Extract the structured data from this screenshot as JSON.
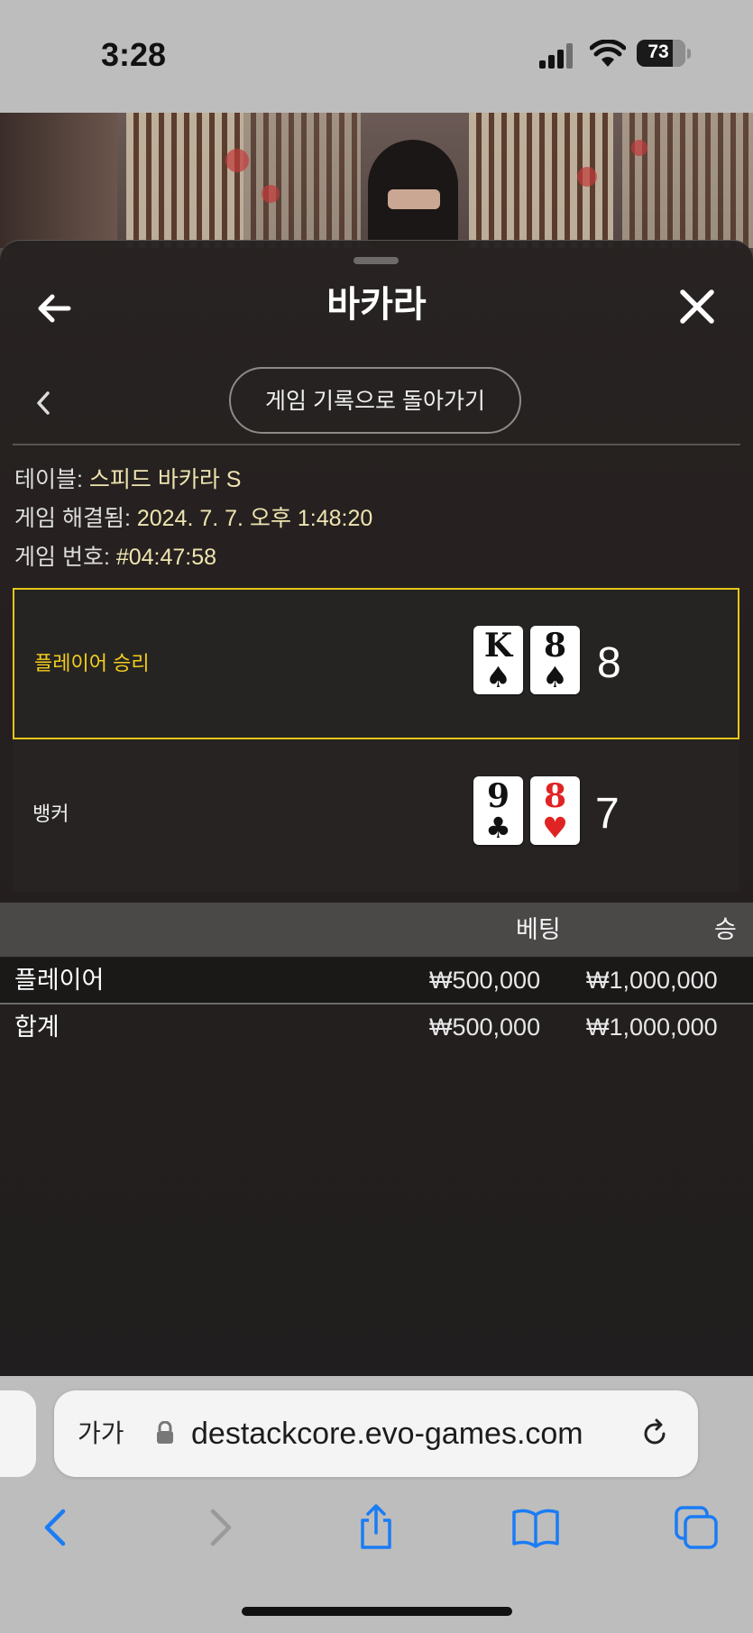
{
  "status": {
    "time": "3:28",
    "battery": "73"
  },
  "sheet": {
    "title": "바카라",
    "history_button": "게임 기록으로 돌아가기",
    "info": [
      {
        "label": "테이블: ",
        "value": "스피드 바카라 S"
      },
      {
        "label": "게임 해결됨: ",
        "value": "2024. 7. 7. 오후 1:48:20"
      },
      {
        "label": "게임 번호: ",
        "value": "#04:47:58"
      }
    ],
    "results": {
      "player": {
        "label": "플레이어 승리",
        "cards": [
          {
            "rank": "K",
            "suit": "♠"
          },
          {
            "rank": "8",
            "suit": "♠"
          }
        ],
        "score": "8"
      },
      "banker": {
        "label": "뱅커",
        "cards": [
          {
            "rank": "9",
            "suit": "♣"
          },
          {
            "rank": "8",
            "suit": "♥"
          }
        ],
        "score": "7"
      }
    },
    "bets": {
      "headers": {
        "bet": "베팅",
        "win": "승"
      },
      "rows": [
        {
          "name": "플레이어",
          "bet": "₩500,000",
          "win": "₩1,000,000"
        },
        {
          "name": "합계",
          "bet": "₩500,000",
          "win": "₩1,000,000"
        }
      ]
    }
  },
  "browser": {
    "text_size_label": "가가",
    "url": "destackcore.evo-games.com"
  },
  "colors": {
    "win_highlight": "#e6c619",
    "link_blue": "#1a7cf5"
  }
}
